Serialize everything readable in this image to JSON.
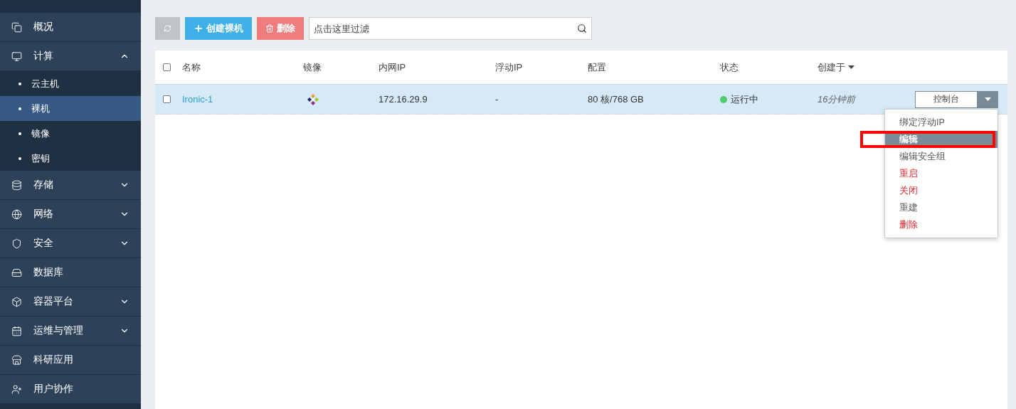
{
  "sidebar": {
    "items": [
      {
        "label": "概况",
        "selected": false
      },
      {
        "label": "计算",
        "selected": false,
        "expanded": true,
        "children": [
          {
            "label": "云主机",
            "selected": false
          },
          {
            "label": "裸机",
            "selected": true
          },
          {
            "label": "镜像",
            "selected": false
          },
          {
            "label": "密钥",
            "selected": false
          }
        ]
      },
      {
        "label": "存储",
        "selected": false,
        "expanded": false
      },
      {
        "label": "网络",
        "selected": false,
        "expanded": false
      },
      {
        "label": "安全",
        "selected": false,
        "expanded": false
      },
      {
        "label": "数据库",
        "selected": false
      },
      {
        "label": "容器平台",
        "selected": false,
        "expanded": false
      },
      {
        "label": "运维与管理",
        "selected": false,
        "expanded": false
      },
      {
        "label": "科研应用",
        "selected": false
      },
      {
        "label": "用户协作",
        "selected": false
      }
    ]
  },
  "toolbar": {
    "refresh_disabled": true,
    "create_button": "创建裸机",
    "delete_button": "删除",
    "filter": {
      "placeholder": "点击这里过滤"
    }
  },
  "table": {
    "select_all": {
      "checked": false
    },
    "columns": [
      {
        "label": "名称",
        "sorted": false
      },
      {
        "label": "镜像",
        "sorted": false
      },
      {
        "label": "内网IP",
        "sorted": false
      },
      {
        "label": "浮动IP",
        "sorted": false
      },
      {
        "label": "配置",
        "sorted": false
      },
      {
        "label": "状态",
        "sorted": false
      },
      {
        "label": "创建于",
        "sorted": true
      }
    ],
    "rows": [
      {
        "selected": true,
        "checked": false,
        "name": "Ironic-1",
        "internal_ip": "172.16.29.9",
        "floating_ip": "-",
        "config": "80 核/768 GB",
        "status": {
          "color": "#4cce6a",
          "label": "运行中"
        },
        "created": "16分钟前",
        "action": "控制台"
      }
    ]
  },
  "action_menu": {
    "items": [
      {
        "label": "绑定浮动IP",
        "kind": "normal",
        "selected": false
      },
      {
        "label": "编辑",
        "kind": "normal",
        "selected": true
      },
      {
        "label": "编辑安全组",
        "kind": "normal",
        "selected": false
      },
      {
        "label": "重启",
        "kind": "danger",
        "selected": false
      },
      {
        "label": "关闭",
        "kind": "danger",
        "selected": false
      },
      {
        "label": "重建",
        "kind": "normal",
        "selected": false
      },
      {
        "label": "删除",
        "kind": "danger",
        "selected": false
      }
    ]
  }
}
